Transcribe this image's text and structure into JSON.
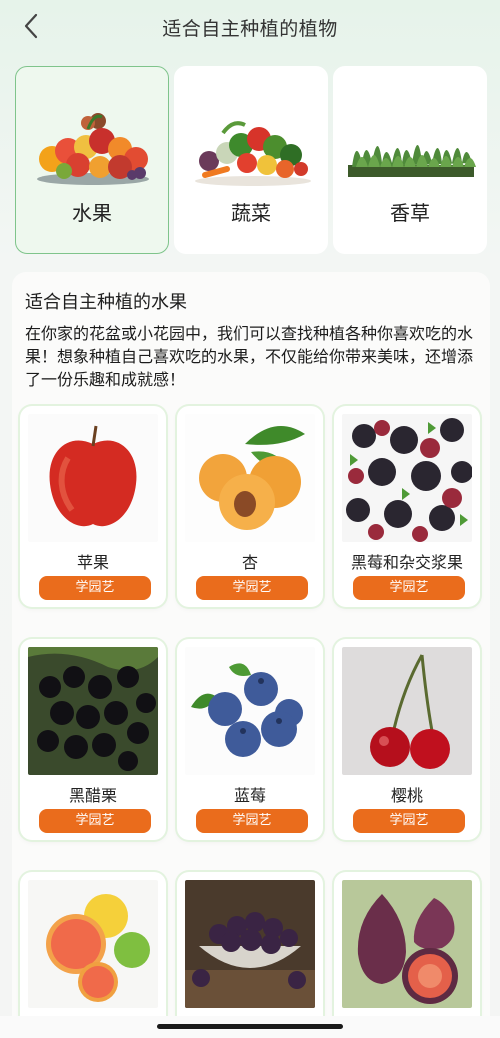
{
  "header": {
    "title": "适合自主种植的植物",
    "back_icon": "chevron-left-icon"
  },
  "categories": [
    {
      "label": "水果",
      "selected": true,
      "image": "fruit-basket-image"
    },
    {
      "label": "蔬菜",
      "selected": false,
      "image": "vegetables-image"
    },
    {
      "label": "香草",
      "selected": false,
      "image": "herbs-image"
    }
  ],
  "section": {
    "title": "适合自主种植的水果",
    "description": "在你家的花盆或小花园中，我们可以查找种植各种你喜欢吃的水果！想象种植自己喜欢吃的水果，不仅能给你带来美味，还增添了一份乐趣和成就感！"
  },
  "plants": [
    {
      "name": "苹果",
      "button": "学园艺",
      "image": "apple-image"
    },
    {
      "name": "杏",
      "button": "学园艺",
      "image": "apricot-image"
    },
    {
      "name": "黑莓和杂交浆果",
      "button": "学园艺",
      "image": "blackberry-image"
    },
    {
      "name": "黑醋栗",
      "button": "学园艺",
      "image": "blackcurrant-image"
    },
    {
      "name": "蓝莓",
      "button": "学园艺",
      "image": "blueberry-image"
    },
    {
      "name": "樱桃",
      "button": "学园艺",
      "image": "cherry-image"
    },
    {
      "name": "",
      "button": "",
      "image": "grapefruit-image"
    },
    {
      "name": "",
      "button": "",
      "image": "plum-image"
    },
    {
      "name": "",
      "button": "",
      "image": "fig-image"
    }
  ],
  "colors": {
    "accent": "#ea6c1c",
    "selected_border": "#7fc48b",
    "selected_bg": "#eef8ee"
  }
}
